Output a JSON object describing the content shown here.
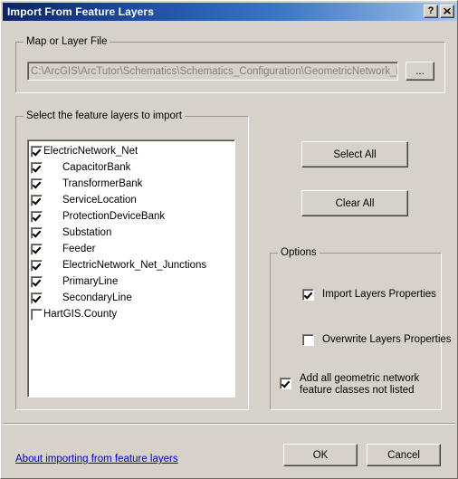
{
  "window": {
    "title": "Import From Feature Layers",
    "help_button": "?",
    "close_button": "×"
  },
  "map_file_group": {
    "legend": "Map or Layer File",
    "path_value": "C:\\ArcGIS\\ArcTutor\\Schematics\\Schematics_Configuration\\GeometricNetwork_Data\\W",
    "browse_label": "..."
  },
  "layers_group": {
    "legend": "Select the feature layers to import",
    "items": [
      {
        "label": "ElectricNetwork_Net",
        "checked": true,
        "indent": false
      },
      {
        "label": "CapacitorBank",
        "checked": true,
        "indent": true
      },
      {
        "label": "TransformerBank",
        "checked": true,
        "indent": true
      },
      {
        "label": "ServiceLocation",
        "checked": true,
        "indent": true
      },
      {
        "label": "ProtectionDeviceBank",
        "checked": true,
        "indent": true
      },
      {
        "label": "Substation",
        "checked": true,
        "indent": true
      },
      {
        "label": "Feeder",
        "checked": true,
        "indent": true
      },
      {
        "label": "ElectricNetwork_Net_Junctions",
        "checked": true,
        "indent": true
      },
      {
        "label": "PrimaryLine",
        "checked": true,
        "indent": true
      },
      {
        "label": "SecondaryLine",
        "checked": true,
        "indent": true
      },
      {
        "label": "HartGIS.County",
        "checked": false,
        "indent": false
      }
    ]
  },
  "side_buttons": {
    "select_all": "Select All",
    "clear_all": "Clear All"
  },
  "options_group": {
    "legend": "Options",
    "import_layers_properties": {
      "label": "Import Layers Properties",
      "checked": true
    },
    "overwrite_layers_properties": {
      "label": "Overwrite Layers Properties",
      "checked": false
    },
    "add_all_geometric": {
      "label_line1": "Add all geometric network",
      "label_line2": "feature classes not listed",
      "checked": true
    }
  },
  "footer": {
    "help_link": "About importing from feature layers",
    "ok_label": "OK",
    "cancel_label": "Cancel"
  },
  "colors": {
    "dialog_face": "#d6d2c9",
    "title_start": "#0a246a",
    "title_end": "#a6c8ec",
    "link": "#0000cc",
    "disabled_text": "#85817a"
  }
}
